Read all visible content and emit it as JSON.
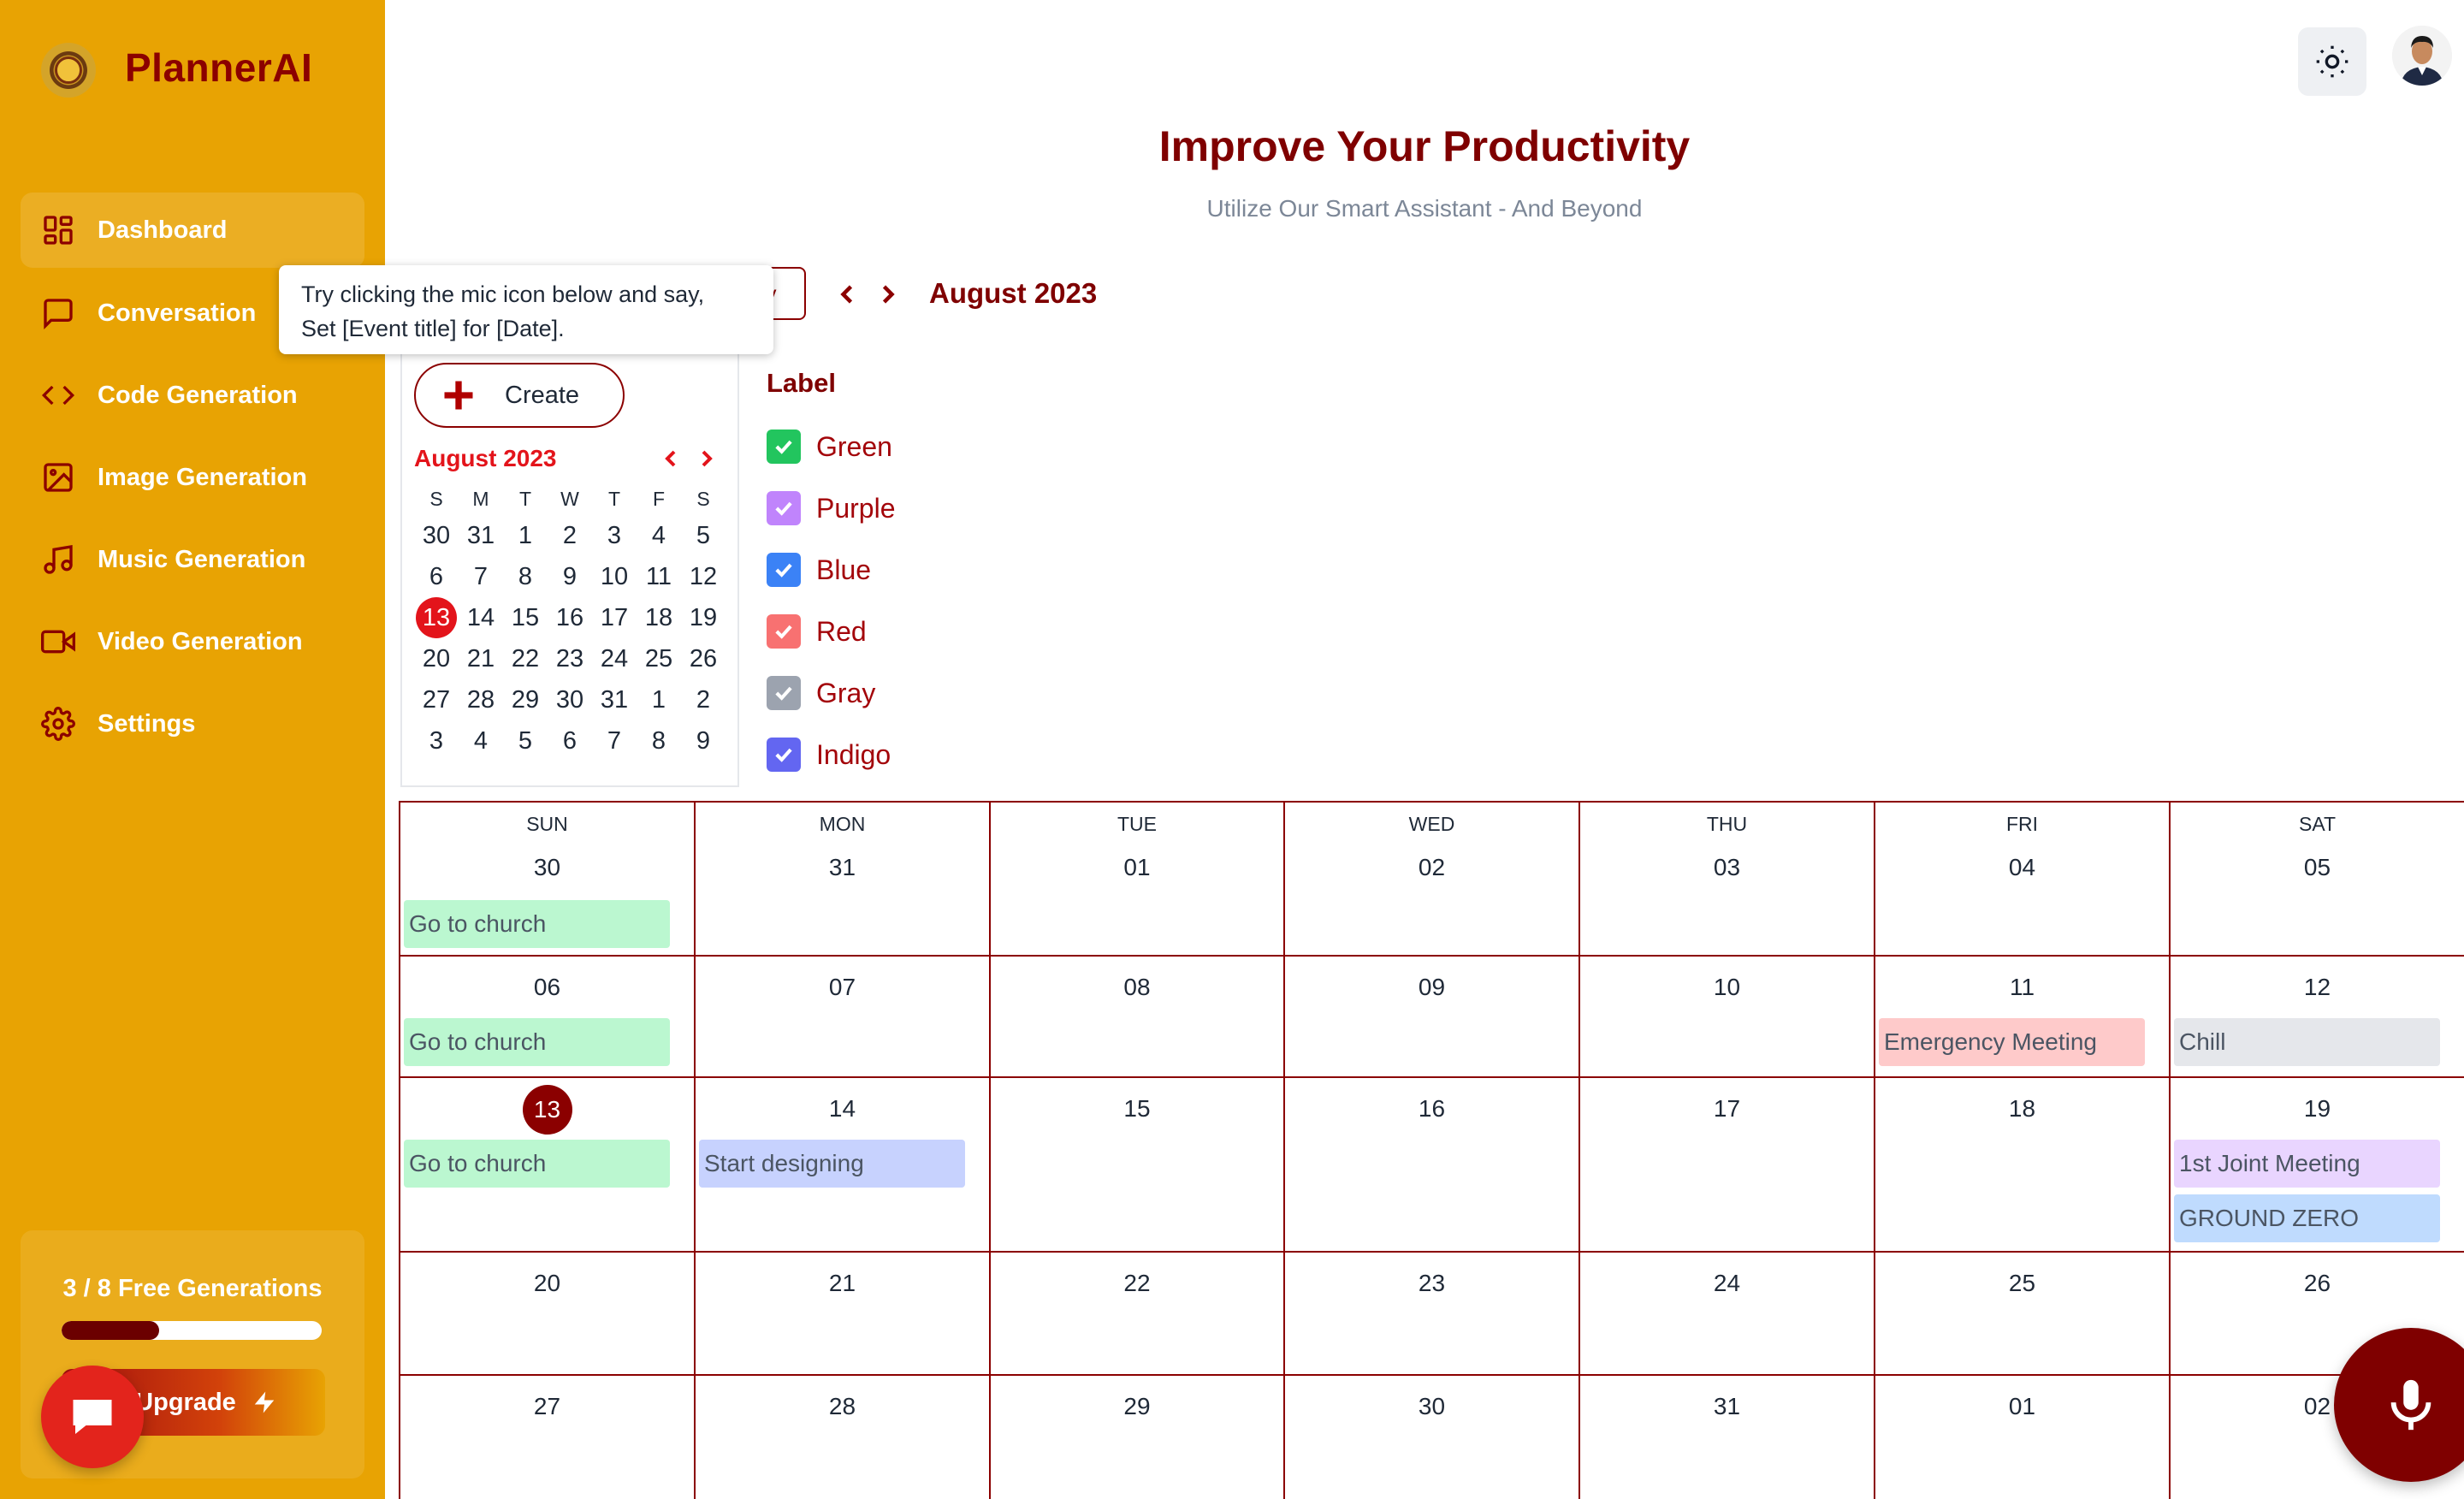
{
  "brand": {
    "name": "PlannerAI"
  },
  "sidebar": {
    "items": [
      {
        "label": "Dashboard",
        "icon": "dashboard-icon",
        "active": true
      },
      {
        "label": "Conversation",
        "icon": "chat-icon"
      },
      {
        "label": "Code Generation",
        "icon": "code-icon"
      },
      {
        "label": "Image Generation",
        "icon": "image-icon"
      },
      {
        "label": "Music Generation",
        "icon": "music-icon"
      },
      {
        "label": "Video Generation",
        "icon": "video-icon"
      },
      {
        "label": "Settings",
        "icon": "settings-icon"
      }
    ],
    "generations": {
      "text": "3 / 8 Free Generations",
      "used": 3,
      "total": 8
    },
    "upgrade_label": "Upgrade"
  },
  "header": {
    "title": "Improve Your Productivity",
    "subtitle": "Utilize Our Smart Assistant - And Beyond"
  },
  "toolbar": {
    "today_label": "y",
    "month_label": "August 2023"
  },
  "tooltip": {
    "line1": "Try clicking the mic icon below and say,",
    "line2": "Set [Event title] for [Date]."
  },
  "mini_calendar": {
    "create_label": "Create",
    "month_label": "August 2023",
    "weekdays": [
      "S",
      "M",
      "T",
      "W",
      "T",
      "F",
      "S"
    ],
    "weeks": [
      [
        "30",
        "31",
        "1",
        "2",
        "3",
        "4",
        "5"
      ],
      [
        "6",
        "7",
        "8",
        "9",
        "10",
        "11",
        "12"
      ],
      [
        "13",
        "14",
        "15",
        "16",
        "17",
        "18",
        "19"
      ],
      [
        "20",
        "21",
        "22",
        "23",
        "24",
        "25",
        "26"
      ],
      [
        "27",
        "28",
        "29",
        "30",
        "31",
        "1",
        "2"
      ],
      [
        "3",
        "4",
        "5",
        "6",
        "7",
        "8",
        "9"
      ]
    ],
    "today": "13"
  },
  "labels": {
    "heading": "Label",
    "items": [
      {
        "name": "Green",
        "color": "#22c55e"
      },
      {
        "name": "Purple",
        "color": "#c084fc"
      },
      {
        "name": "Blue",
        "color": "#3b82f6"
      },
      {
        "name": "Red",
        "color": "#f87171"
      },
      {
        "name": "Gray",
        "color": "#9ca3af"
      },
      {
        "name": "Indigo",
        "color": "#6366f1"
      }
    ]
  },
  "month_grid": {
    "weekdays": [
      "SUN",
      "MON",
      "TUE",
      "WED",
      "THU",
      "FRI",
      "SAT"
    ],
    "weeks": [
      [
        "30",
        "31",
        "01",
        "02",
        "03",
        "04",
        "05"
      ],
      [
        "06",
        "07",
        "08",
        "09",
        "10",
        "11",
        "12"
      ],
      [
        "13",
        "14",
        "15",
        "16",
        "17",
        "18",
        "19"
      ],
      [
        "20",
        "21",
        "22",
        "23",
        "24",
        "25",
        "26"
      ],
      [
        "27",
        "28",
        "29",
        "30",
        "31",
        "01",
        "02"
      ]
    ],
    "today": "13",
    "events": [
      {
        "week": 0,
        "day": 0,
        "title": "Go to church",
        "color": "#bbf7d0"
      },
      {
        "week": 1,
        "day": 0,
        "title": "Go to church",
        "color": "#bbf7d0"
      },
      {
        "week": 1,
        "day": 5,
        "title": "Emergency Meeting",
        "color": "#fecaca"
      },
      {
        "week": 1,
        "day": 6,
        "title": "Chill",
        "color": "#e5e7eb"
      },
      {
        "week": 2,
        "day": 0,
        "title": "Go to church",
        "color": "#bbf7d0"
      },
      {
        "week": 2,
        "day": 1,
        "title": "Start designing",
        "color": "#c7d2fe"
      },
      {
        "week": 2,
        "day": 6,
        "title": "1st Joint Meeting",
        "color": "#e9d5ff"
      },
      {
        "week": 2,
        "day": 6,
        "title": "GROUND ZERO",
        "color": "#bfdbfe"
      }
    ]
  },
  "colors": {
    "sidebar": "#e8a303",
    "brand": "#8b0000",
    "accent_red": "#e3141b"
  }
}
